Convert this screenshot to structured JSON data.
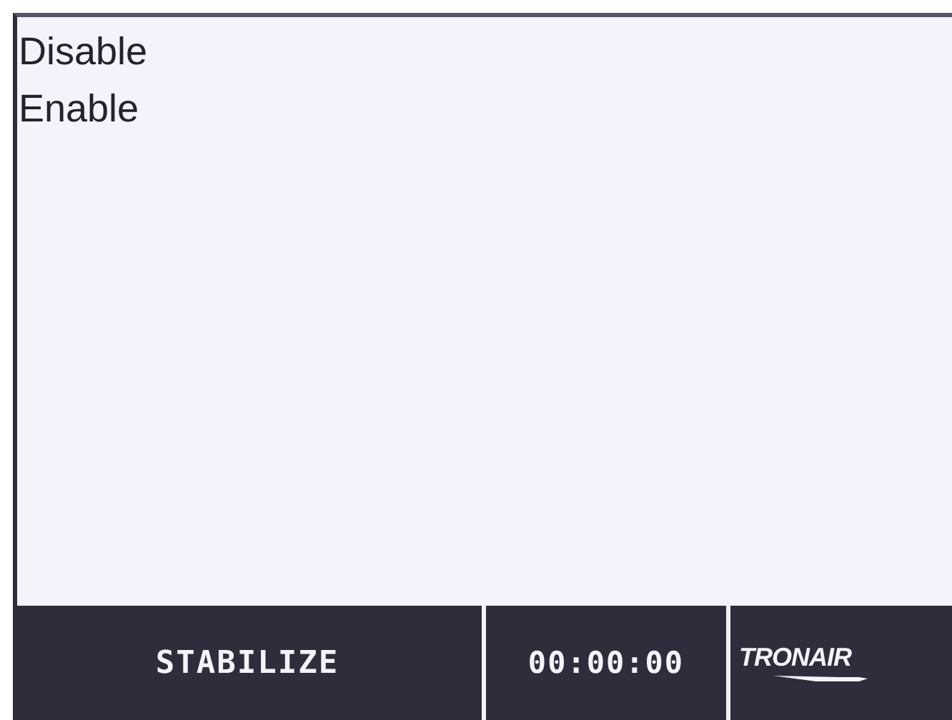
{
  "menu": {
    "items": [
      {
        "label": "Disable"
      },
      {
        "label": "Enable"
      }
    ]
  },
  "status_bar": {
    "mode": "STABILIZE",
    "timer": "00:00:00",
    "logo": "TRONAIR"
  }
}
